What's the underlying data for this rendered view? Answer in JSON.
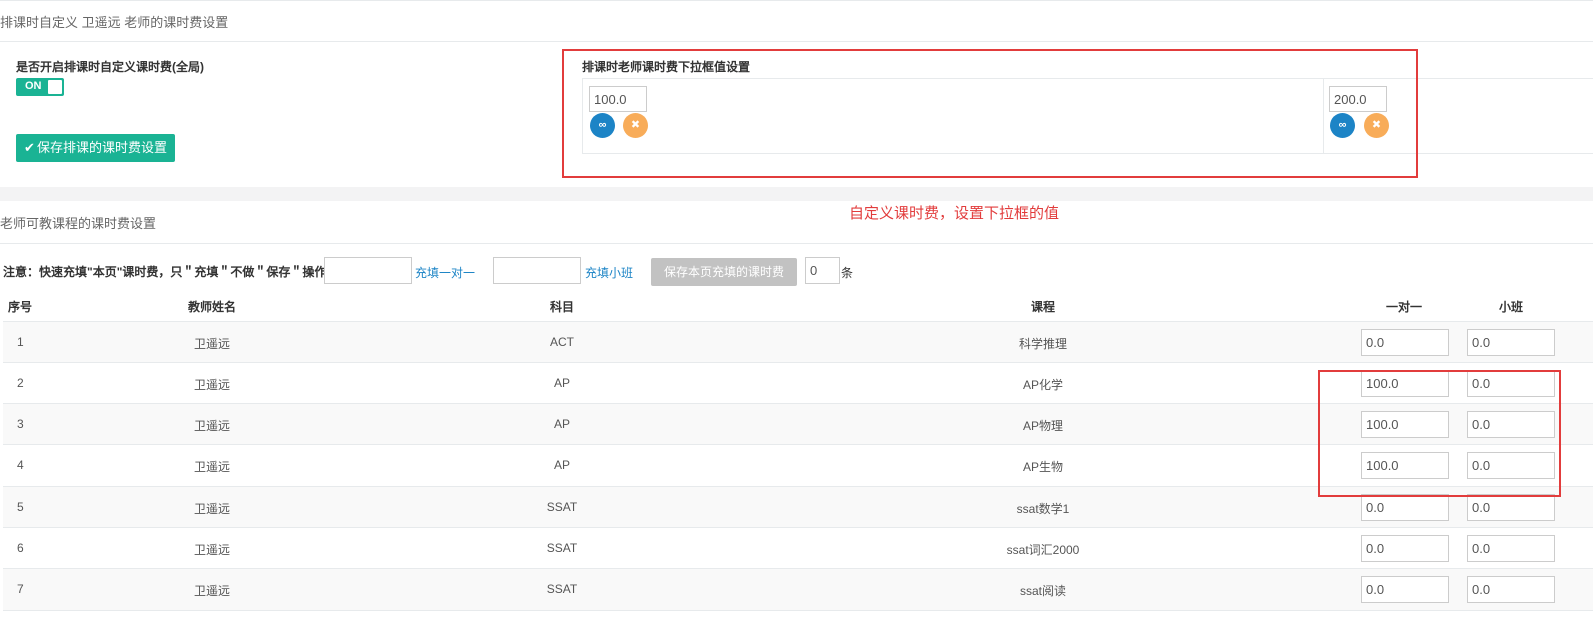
{
  "header": {
    "title": "排课时自定义 卫遥远 老师的课时费设置"
  },
  "global": {
    "toggle_label": "是否开启排课时自定义课时费(全局)",
    "toggle_value": "ON",
    "save_button": "保存排课的课时费设置"
  },
  "dropdown": {
    "title": "排课时老师课时费下拉框值设置",
    "values": [
      "100.0",
      "200.0"
    ]
  },
  "annotation": "自定义课时费，设置下拉框的值",
  "section2": {
    "title": "老师可教课程的课时费设置"
  },
  "quickfill": {
    "notice": "注意：快速充填\"本页\"课时费，只＂充填＂不做＂保存＂操作",
    "one_on_one_link": "充填一对一",
    "small_class_link": "充填小班",
    "save_button": "保存本页充填的课时费",
    "count_value": "0",
    "count_unit": "条"
  },
  "table": {
    "headers": [
      "序号",
      "教师姓名",
      "科目",
      "课程",
      "一对一",
      "小班"
    ],
    "rows": [
      {
        "no": "1",
        "teacher": "卫遥远",
        "subject": "ACT",
        "course": "科学推理",
        "one": "0.0",
        "small": "0.0"
      },
      {
        "no": "2",
        "teacher": "卫遥远",
        "subject": "AP",
        "course": "AP化学",
        "one": "100.0",
        "small": "0.0"
      },
      {
        "no": "3",
        "teacher": "卫遥远",
        "subject": "AP",
        "course": "AP物理",
        "one": "100.0",
        "small": "0.0"
      },
      {
        "no": "4",
        "teacher": "卫遥远",
        "subject": "AP",
        "course": "AP生物",
        "one": "100.0",
        "small": "0.0"
      },
      {
        "no": "5",
        "teacher": "卫遥远",
        "subject": "SSAT",
        "course": "ssat数学1",
        "one": "0.0",
        "small": "0.0"
      },
      {
        "no": "6",
        "teacher": "卫遥远",
        "subject": "SSAT",
        "course": "ssat词汇2000",
        "one": "0.0",
        "small": "0.0"
      },
      {
        "no": "7",
        "teacher": "卫遥远",
        "subject": "SSAT",
        "course": "ssat阅读",
        "one": "0.0",
        "small": "0.0"
      }
    ]
  },
  "colors": {
    "green": "#1ab394",
    "blue": "#1c84c6",
    "orange": "#f8ac59",
    "red_annotation": "#e23c3c"
  }
}
